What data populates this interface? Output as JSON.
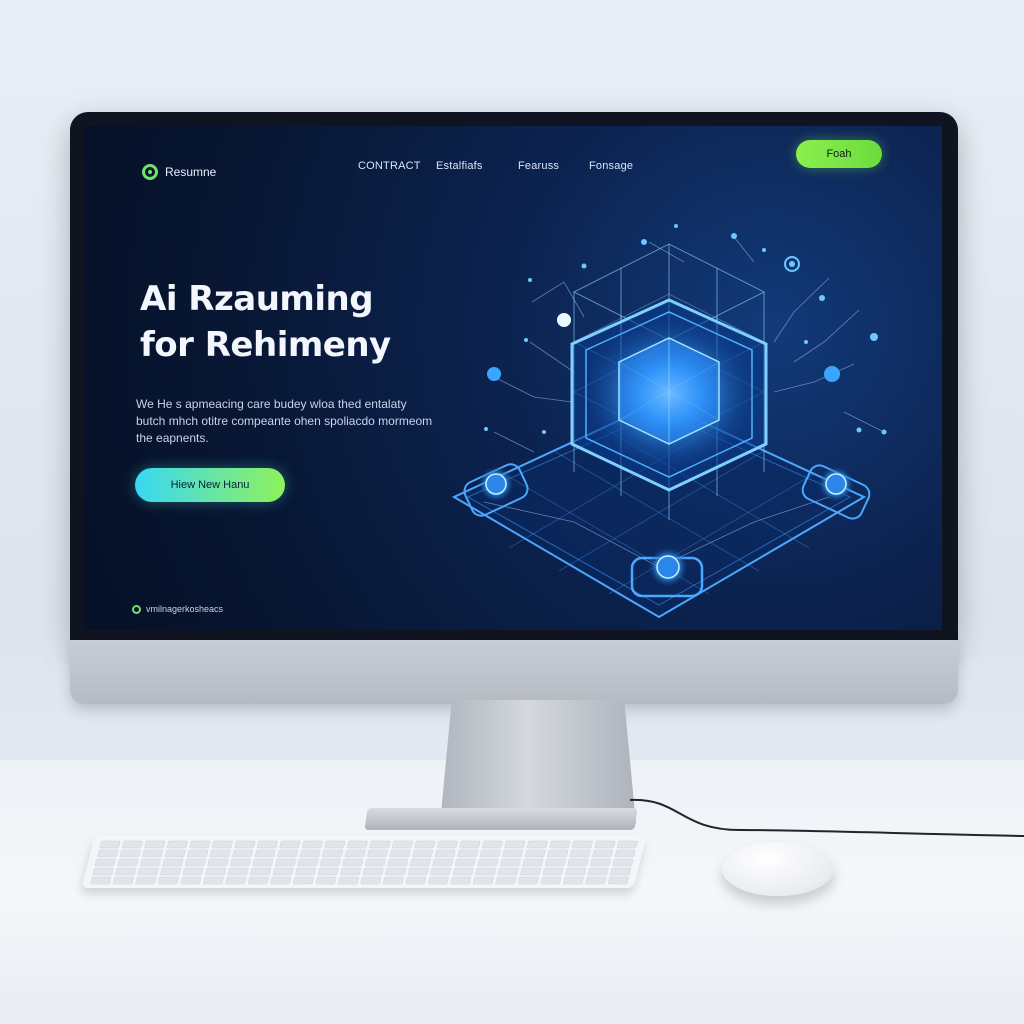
{
  "nav": {
    "logo_text": "Resumne",
    "links": [
      "CONTRACT",
      "Estalfiafs",
      "Fearuss",
      "Fonsage"
    ],
    "cta_label": "Foah"
  },
  "hero": {
    "title_line1": "Ai Rzauming",
    "title_line2": "for Rehimeny",
    "description": "We He s apmeacing care budey wloa thed entalaty butch mhch otitre compeante ohen spoliacdo mormeom the eapnents.",
    "cta_label": "Hiew New Hanu"
  },
  "footer": {
    "note": "vmilnagerkosheacs"
  },
  "icons": {
    "logo": "logo-icon",
    "footer": "footer-icon",
    "illustration": "isometric-cube-network-illustration"
  },
  "colors": {
    "accent_green": "#7CEB4A",
    "accent_cyan": "#38D8F3",
    "screen_bg": "#0A1E45",
    "glow_blue": "#2F9BFF"
  }
}
